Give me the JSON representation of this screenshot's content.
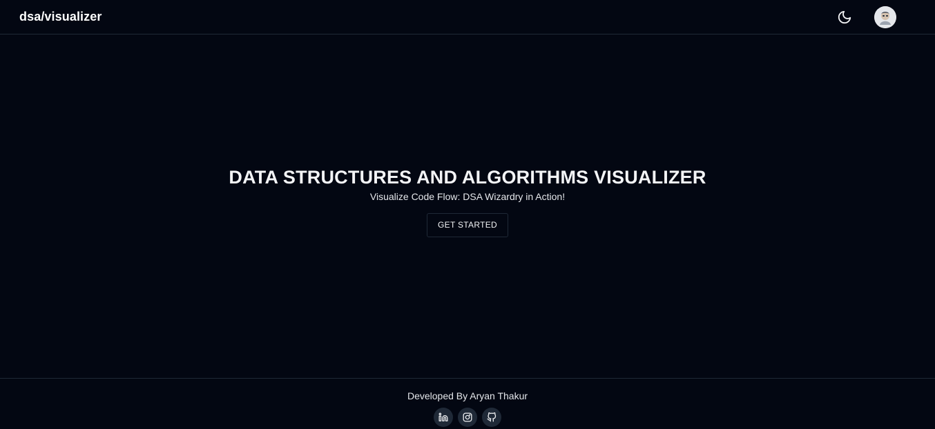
{
  "header": {
    "brand": "dsa/visualizer",
    "theme_toggle_icon": "moon-icon",
    "avatar_icon": "user-avatar"
  },
  "hero": {
    "title": "DATA STRUCTURES AND ALGORITHMS VISUALIZER",
    "subtitle": "Visualize Code Flow: DSA Wizardry in Action!",
    "cta_label": "GET STARTED"
  },
  "footer": {
    "credit": "Developed By Aryan Thakur",
    "socials": [
      {
        "icon": "linkedin-icon"
      },
      {
        "icon": "instagram-icon"
      },
      {
        "icon": "github-icon"
      }
    ]
  },
  "colors": {
    "background": "#030712",
    "border": "#1f2937",
    "text": "#f3f4f6",
    "social_bg": "#1f2937"
  }
}
